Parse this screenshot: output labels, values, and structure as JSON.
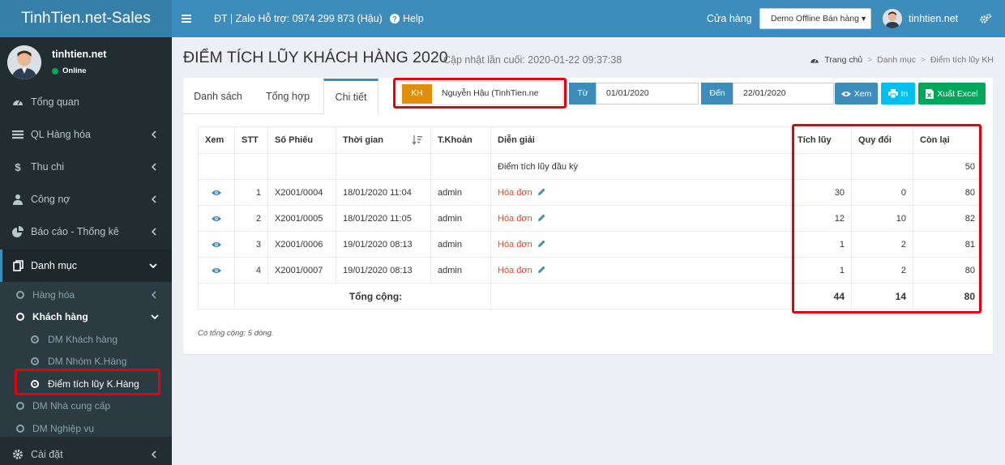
{
  "app": {
    "brand": "TinhTien.net-Sales"
  },
  "topbar": {
    "contact": "ĐT | Zalo Hỗ trợ: 0974 299 873 (Hậu)",
    "help": "Help",
    "store_label": "Cửa hàng",
    "store_value": "Demo Offline Bán hàng",
    "user": "tinhtien.net"
  },
  "sidebar": {
    "user_name": "tinhtien.net",
    "status": "Online",
    "items": [
      {
        "label": "Tổng quan",
        "icon": "dashboard-icon"
      },
      {
        "label": "QL Hàng hóa",
        "icon": "list-icon"
      },
      {
        "label": "Thu chi",
        "icon": "dollar-icon"
      },
      {
        "label": "Công nợ",
        "icon": "user-icon"
      },
      {
        "label": "Báo cáo - Thống kê",
        "icon": "pie-chart-icon"
      },
      {
        "label": "Danh mục",
        "icon": "copy-icon"
      },
      {
        "label": "Cài đặt",
        "icon": "gear-icon"
      }
    ],
    "sub": {
      "hang_hoa": "Hàng hóa",
      "khach_hang": "Khách hàng",
      "dm_khach_hang": "DM Khách hàng",
      "dm_nhom": "DM Nhóm K.Hàng",
      "diem_tich_luy": "Điểm tích lũy K.Hàng",
      "nha_cung_cap": "DM Nhà cung cấp",
      "nghiep_vu": "DM Nghiệp vụ"
    }
  },
  "page": {
    "title": "ĐIỂM TÍCH LŨY KHÁCH HÀNG 2020",
    "subtitle": "Cập nhật lần cuối: 2020-01-22 09:37:38",
    "breadcrumb": [
      "Trang chủ",
      "Danh mục",
      "Điểm tích lũy KH"
    ]
  },
  "tabs": [
    "Danh sách",
    "Tổng hợp",
    "Chi tiết"
  ],
  "filters": {
    "kh_label": "KH",
    "kh_value": "Nguyễn Hậu (TinhTien.net)",
    "from_label": "Từ",
    "from_value": "01/01/2020",
    "to_label": "Đến",
    "to_value": "22/01/2020",
    "view_btn": "Xem",
    "print_btn": "In",
    "excel_btn": "Xuất Excel"
  },
  "table": {
    "headers": [
      "Xem",
      "STT",
      "Số Phiếu",
      "Thời gian",
      "T.Khoản",
      "Diễn giải",
      "Tích lũy",
      "Quy đổi",
      "Còn lại"
    ],
    "opening": {
      "desc": "Điểm tích lũy đầu kỳ",
      "con_lai": "50"
    },
    "rows": [
      {
        "stt": "1",
        "so_phieu": "X2001/0004",
        "thoi_gian": "18/01/2020 11:04",
        "tk": "admin",
        "desc": "Hóa đơn",
        "tich_luy": "30",
        "quy_doi": "0",
        "con_lai": "80"
      },
      {
        "stt": "2",
        "so_phieu": "X2001/0005",
        "thoi_gian": "18/01/2020 11:05",
        "tk": "admin",
        "desc": "Hóa đơn",
        "tich_luy": "12",
        "quy_doi": "10",
        "con_lai": "82"
      },
      {
        "stt": "3",
        "so_phieu": "X2001/0006",
        "thoi_gian": "19/01/2020 08:13",
        "tk": "admin",
        "desc": "Hóa đơn",
        "tich_luy": "1",
        "quy_doi": "2",
        "con_lai": "81"
      },
      {
        "stt": "4",
        "so_phieu": "X2001/0007",
        "thoi_gian": "19/01/2020 08:13",
        "tk": "admin",
        "desc": "Hóa đơn",
        "tich_luy": "1",
        "quy_doi": "2",
        "con_lai": "80"
      }
    ],
    "total": {
      "label": "Tổng cộng:",
      "tich_luy": "44",
      "quy_doi": "14",
      "con_lai": "80"
    },
    "footnote": "Có tổng cộng: 5 dòng."
  },
  "colors": {
    "primary": "#3c8dbc",
    "sidebar": "#222d32",
    "highlight": "#e3000f",
    "kh_badge": "#e08e0b",
    "excel": "#00a65a"
  }
}
